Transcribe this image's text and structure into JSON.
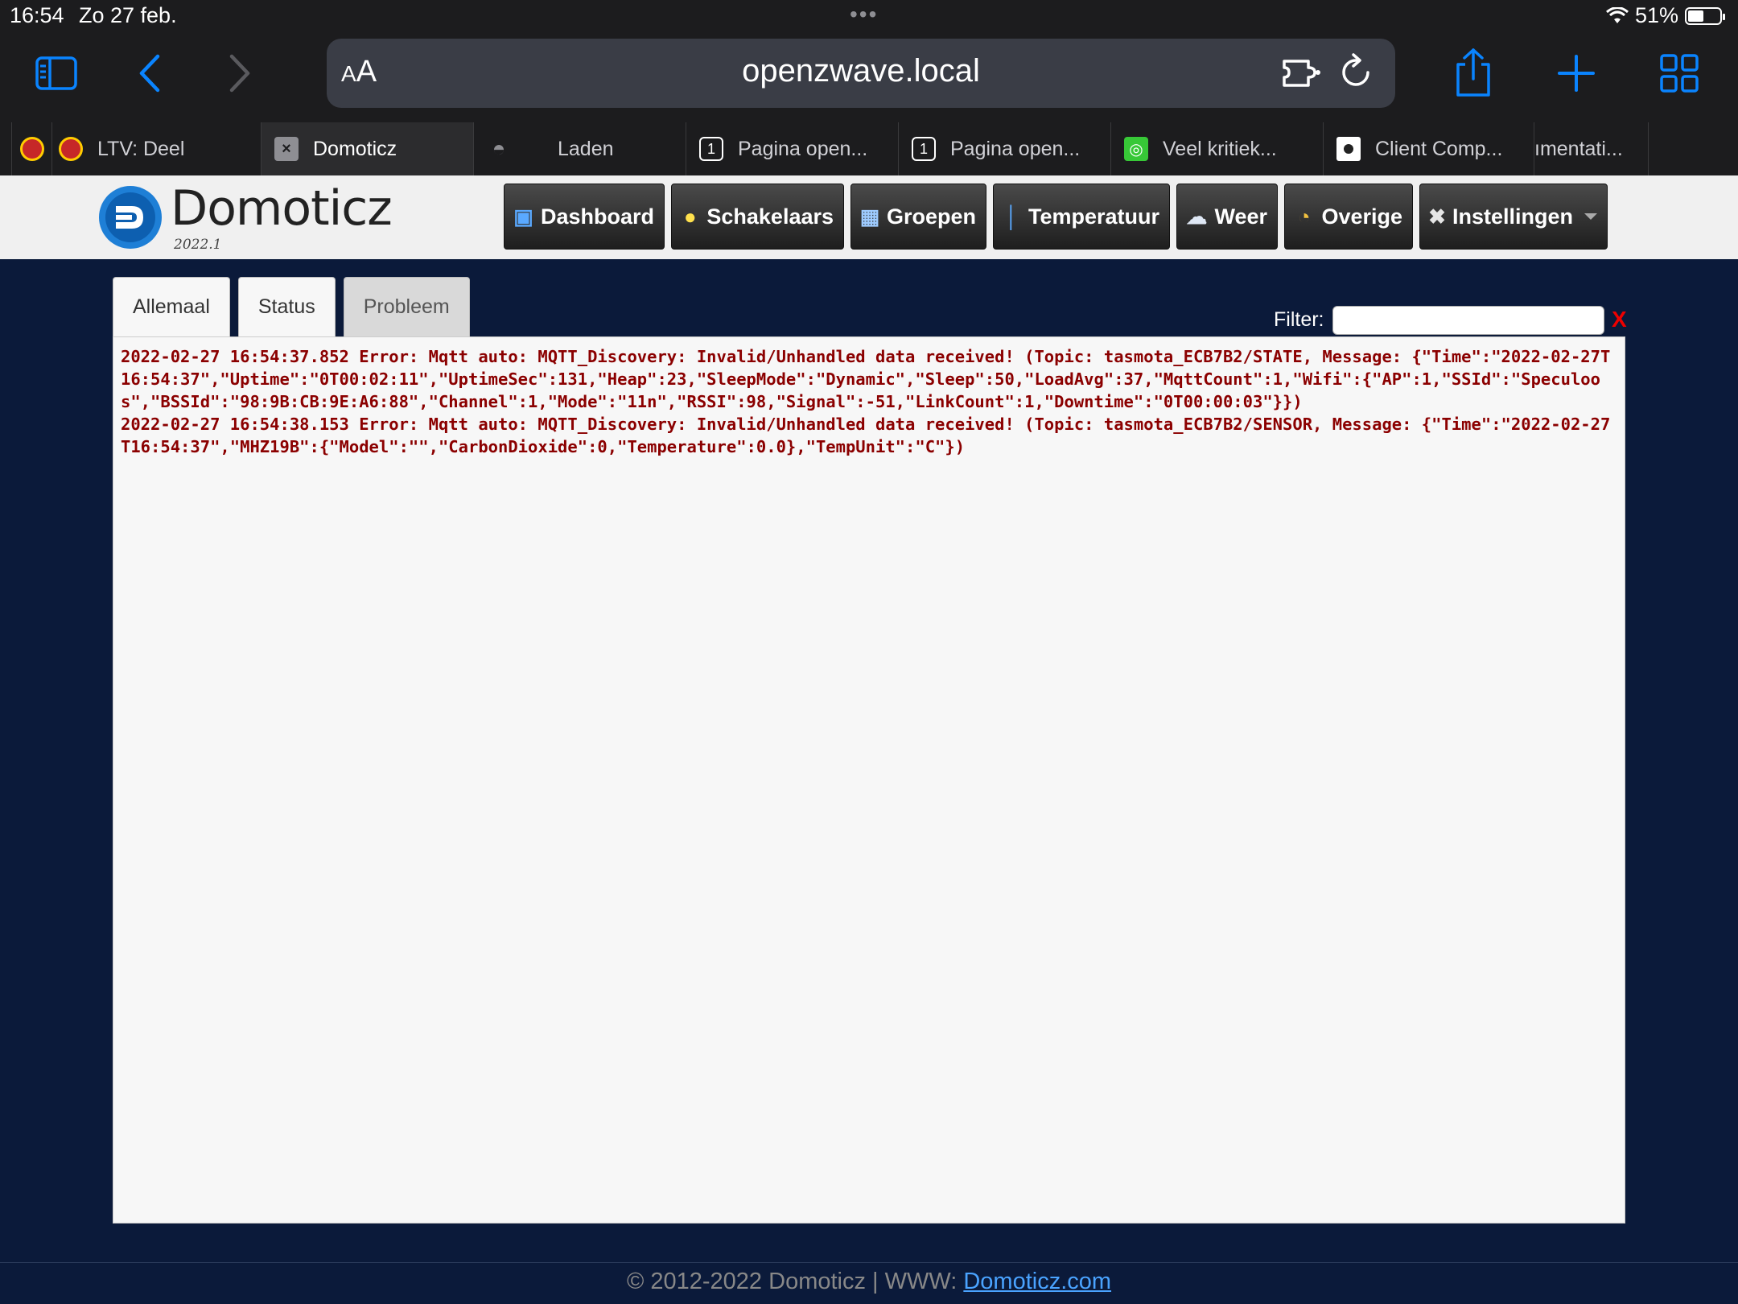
{
  "status_bar": {
    "time": "16:54",
    "date": "Zo 27 feb.",
    "battery": "51%",
    "battery_level": 0.51
  },
  "browser": {
    "url": "openzwave.local",
    "text_size_label": "AA"
  },
  "tabs": [
    {
      "label": "",
      "favicon": "ltv-icon"
    },
    {
      "label": "LTV: Deel",
      "favicon": "ltv-icon"
    },
    {
      "label": "Domoticz",
      "favicon": "close-icon",
      "active": true
    },
    {
      "label": "Laden",
      "favicon": "compass-icon"
    },
    {
      "label": "Pagina open...",
      "favicon": "number-one-icon"
    },
    {
      "label": "Pagina open...",
      "favicon": "number-one-icon"
    },
    {
      "label": "Veel kritiek...",
      "favicon": "globe-icon"
    },
    {
      "label": "Client Comp...",
      "favicon": "flag-icon"
    },
    {
      "label": "ımentati...",
      "favicon": ""
    },
    {
      "label": "",
      "favicon": ""
    }
  ],
  "app": {
    "brand": "Domoticz",
    "version": "2022.1",
    "brand_color": "#1e7fd6"
  },
  "nav": {
    "dashboard": "Dashboard",
    "switches": "Schakelaars",
    "groups": "Groepen",
    "temperature": "Temperatuur",
    "weather": "Weer",
    "other": "Overige",
    "settings": "Instellingen"
  },
  "log": {
    "tabs": {
      "all": "Allemaal",
      "status": "Status",
      "problem": "Probleem"
    },
    "filter_label": "Filter:",
    "filter_value": "",
    "filter_clear": "X",
    "entries": [
      "2022-02-27 16:54:37.852 Error: Mqtt auto: MQTT_Discovery: Invalid/Unhandled data received! (Topic: tasmota_ECB7B2/STATE, Message: {\"Time\":\"2022-02-27T16:54:37\",\"Uptime\":\"0T00:02:11\",\"UptimeSec\":131,\"Heap\":23,\"SleepMode\":\"Dynamic\",\"Sleep\":50,\"LoadAvg\":37,\"MqttCount\":1,\"Wifi\":{\"AP\":1,\"SSId\":\"Speculoos\",\"BSSId\":\"98:9B:CB:9E:A6:88\",\"Channel\":1,\"Mode\":\"11n\",\"RSSI\":98,\"Signal\":-51,\"LinkCount\":1,\"Downtime\":\"0T00:00:03\"}})",
      "2022-02-27 16:54:38.153 Error: Mqtt auto: MQTT_Discovery: Invalid/Unhandled data received! (Topic: tasmota_ECB7B2/SENSOR, Message: {\"Time\":\"2022-02-27T16:54:37\",\"MHZ19B\":{\"Model\":\"\",\"CarbonDioxide\":0,\"Temperature\":0.0},\"TempUnit\":\"C\"})"
    ],
    "error_color": "#8b0000"
  },
  "footer": {
    "text": "© 2012-2022 Domoticz | WWW: ",
    "link": "Domoticz.com"
  }
}
